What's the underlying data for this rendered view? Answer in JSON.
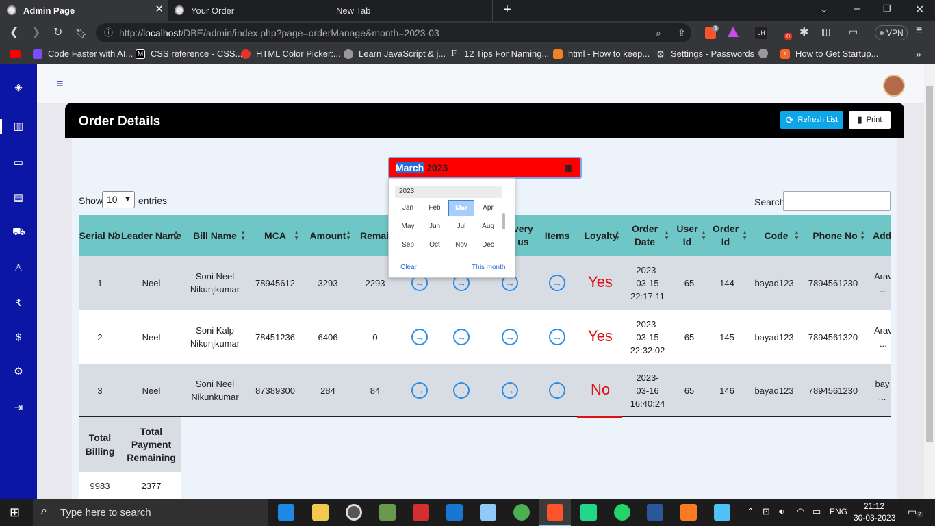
{
  "browser": {
    "tabs": [
      {
        "title": "Admin Page",
        "active": true
      },
      {
        "title": "Your Order",
        "active": false
      },
      {
        "title": "New Tab",
        "active": false
      }
    ],
    "url_prefix": "http://",
    "url_host": "localhost",
    "url_path": "/DBE/admin/index.php?page=orderManage&month=2023-03",
    "vpn_label": "VPN",
    "brave_badge": "3",
    "ext_badge": "0",
    "bookmarks": [
      "Code Faster with AI...",
      "CSS reference - CSS...",
      "HTML Color Picker:...",
      "Learn JavaScript & j...",
      "12 Tips For Naming...",
      "html - How to keep...",
      "Settings - Passwords",
      "How to Get Startup..."
    ]
  },
  "page": {
    "title": "Order Details",
    "refresh_label": "Refresh List",
    "print_label": "Print",
    "month_selected": "March",
    "month_year": " 2023",
    "show_label": "Show",
    "entries_value": "10",
    "entries_label": "entries",
    "search_label": "Search:"
  },
  "calendar": {
    "year": "2023",
    "months": [
      "Jan",
      "Feb",
      "Mar",
      "Apr",
      "May",
      "Jun",
      "Jul",
      "Aug",
      "Sep",
      "Oct",
      "Nov",
      "Dec"
    ],
    "active_month": "Mar",
    "clear_label": "Clear",
    "this_month_label": "This month"
  },
  "table": {
    "headers": [
      "Serial No",
      "Leader Name",
      "Bill Name",
      "MCA",
      "Amount",
      "Remain",
      "very us",
      "Items",
      "Loyalty",
      "Order Date",
      "User Id",
      "Order Id",
      "Code",
      "Phone No",
      "Add"
    ],
    "rows": [
      {
        "serial": "1",
        "leader": "Neel",
        "bill": "Soni Neel Nikunjkumar",
        "mca": "78945612",
        "amount": "3293",
        "remain": "2293",
        "loyalty": "Yes",
        "date": "2023- 03-15 22:17:11",
        "user": "65",
        "order": "144",
        "code": "bayad123",
        "phone": "7894561230",
        "addr": "Arav ..."
      },
      {
        "serial": "2",
        "leader": "Neel",
        "bill": "Soni Kalp Nikunjkumar",
        "mca": "78451236",
        "amount": "6406",
        "remain": "0",
        "loyalty": "Yes",
        "date": "2023- 03-15 22:32:02",
        "user": "65",
        "order": "145",
        "code": "bayad123",
        "phone": "7894561320",
        "addr": "Arav ..."
      },
      {
        "serial": "3",
        "leader": "Neel",
        "bill": "Soni Neel Nikunkumar",
        "mca": "87389300",
        "amount": "284",
        "remain": "84",
        "loyalty": "No",
        "date": "2023- 03-16 16:40:24",
        "user": "65",
        "order": "146",
        "code": "bayad123",
        "phone": "7894561230",
        "addr": "bay ..."
      }
    ]
  },
  "totals": {
    "billing_label": "Total Billing",
    "remaining_label": "Total Payment Remaining",
    "billing_value": "9983",
    "remaining_value": "2377"
  },
  "taskbar": {
    "search_placeholder": "Type here to search",
    "lang": "ENG",
    "time": "21:12",
    "date": "30-03-2023",
    "notifications": "2"
  },
  "colors": {
    "sidebar": "#0c16a4",
    "header": "#000000",
    "table_head": "#6ec6c6",
    "month_input": "#ff0000",
    "loyalty_text": "#e01010",
    "arrow": "#2a8de8"
  }
}
